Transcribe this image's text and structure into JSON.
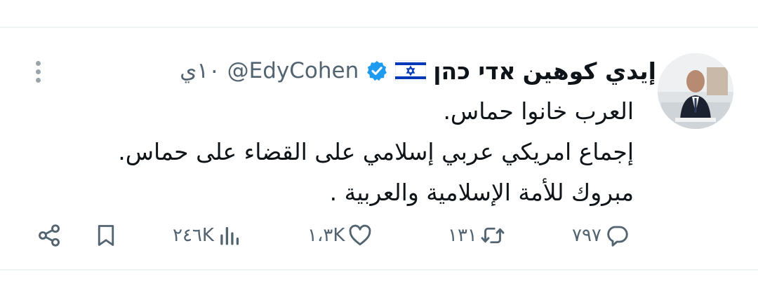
{
  "tweet": {
    "author_name": "إيدي كوهين",
    "author_name_hebrew": "אדי כהן",
    "flag_icon": "israel-flag-icon",
    "verified_icon": "verified-badge-icon",
    "verified_color": "#1d9bf0",
    "handle": "@EdyCohen",
    "time": "١٠ي",
    "lines": [
      "العرب خانوا حماس.",
      "إجماع امريكي عربي إسلامي على القضاء على حماس.",
      "مبروك للأمة الإسلامية والعربية ."
    ]
  },
  "actions": {
    "replies": "٧٩٧",
    "retweets": "١٣١",
    "likes": "١،٣K",
    "views": "٢٤٦K"
  },
  "icons": {
    "reply": "reply-icon",
    "retweet": "retweet-icon",
    "like": "heart-icon",
    "views": "views-icon",
    "bookmark": "bookmark-icon",
    "share": "share-icon",
    "more": "more-vertical-icon"
  }
}
